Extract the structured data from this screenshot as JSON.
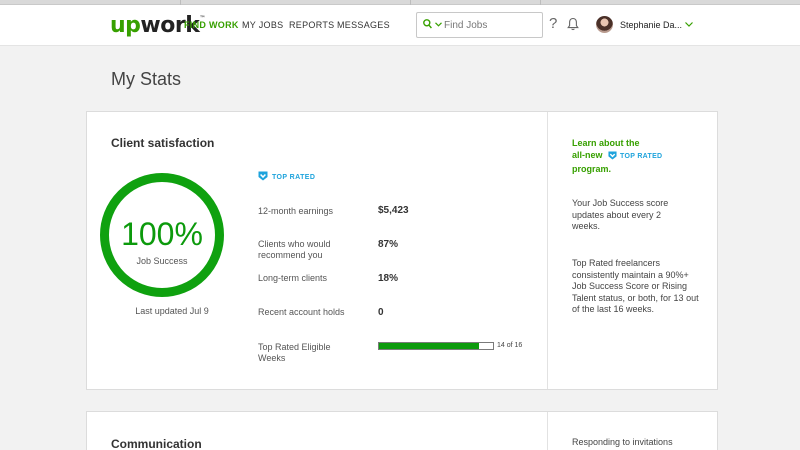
{
  "nav": {
    "logo_prefix": "up",
    "logo_suffix": "work",
    "logo_tm": "™",
    "links": [
      "FIND WORK",
      "MY JOBS",
      "REPORTS",
      "MESSAGES"
    ],
    "active_link": "FIND WORK",
    "search_placeholder": "Find Jobs",
    "help_glyph": "?",
    "user_name": "Stephanie Da...",
    "icons": [
      "search-icon",
      "chevron-down-icon",
      "help-icon",
      "bell-icon",
      "avatar"
    ]
  },
  "page": {
    "title": "My Stats"
  },
  "client_satisfaction": {
    "title": "Client satisfaction",
    "ring_value": "100%",
    "ring_label": "Job Success",
    "last_updated": "Last updated Jul 9",
    "badge": "TOP RATED",
    "stats": [
      {
        "label": "12-month earnings",
        "value": "$5,423"
      },
      {
        "label": "Clients who would recommend you",
        "value": "87%"
      },
      {
        "label": "Long-term clients",
        "value": "18%"
      },
      {
        "label": "Recent account holds",
        "value": "0"
      }
    ],
    "eligible_weeks": {
      "label": "Top Rated Eligible Weeks",
      "current": 14,
      "total": 16,
      "text": "14 of 16"
    },
    "side": {
      "link_line1": "Learn about the",
      "link_line2": "all-new",
      "link_badge": "TOP RATED",
      "link_line3": "program.",
      "note1": "Your Job Success score updates about every 2 weeks.",
      "note2": "Top Rated freelancers consistently maintain a 90%+ Job Success Score or Rising Talent status, or both, for 13 out of the last 16 weeks."
    }
  },
  "communication": {
    "title": "Communication",
    "side_text": "Responding to invitations"
  },
  "colors": {
    "brand_green": "#37a000",
    "ring_green": "#0fa10f",
    "top_rated_blue": "#1ea3dc"
  }
}
